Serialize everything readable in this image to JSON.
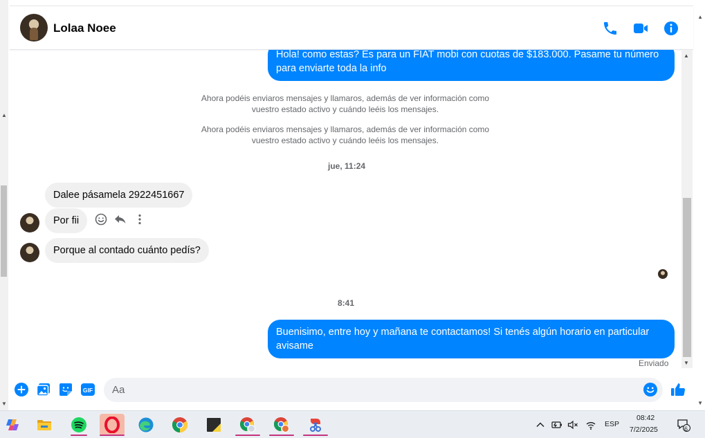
{
  "contact": {
    "name": "Lolaa Noee"
  },
  "messages": {
    "out_1": "Hola! como estas? Es para un FIAT mobi con cuotas de $183.000. Pasame tu número para enviarte toda la info",
    "notice_1": "Ahora podéis enviaros mensajes y llamaros, además de ver información como vuestro estado activo y cuándo leéis los mensajes.",
    "notice_2": "Ahora podéis enviaros mensajes y llamaros, además de ver información como vuestro estado activo y cuándo leéis los mensajes.",
    "time_1": "jue, 11:24",
    "in_1": "Dalee pásamela 2922451667",
    "in_2": "Por fii",
    "in_3": "Porque al contado cuánto pedís?",
    "time_2": "8:41",
    "out_2": "Buenisimo, entre hoy y mañana te contactamos! Si tenés algún horario en particular avisame",
    "status": "Enviado"
  },
  "composer": {
    "placeholder": "Aa"
  },
  "taskbar": {
    "language": "ESP",
    "time": "08:42",
    "date": "7/2/2025",
    "notification_count": "6"
  },
  "colors": {
    "accent": "#0084ff",
    "incoming_bubble": "#f0f0f0",
    "meta_text": "#65676b"
  }
}
